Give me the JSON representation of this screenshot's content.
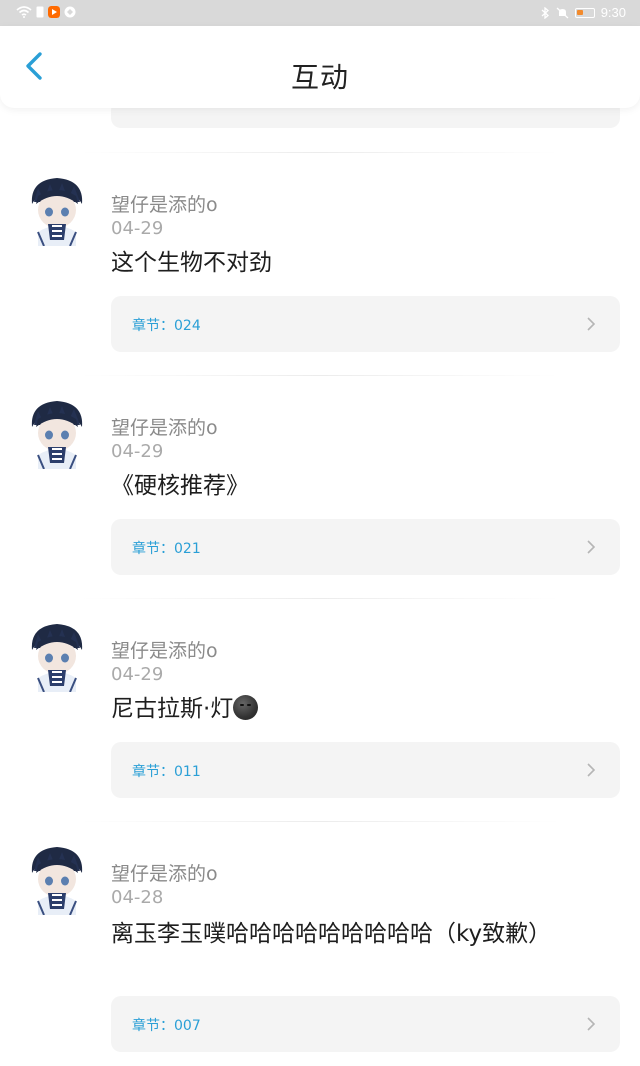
{
  "status": {
    "time": "9:30",
    "colors": {
      "bar": "#d9d9d9",
      "battery_fill": "#f28a2c",
      "app1": "#ff6a00",
      "app2": "#ffffff"
    }
  },
  "header": {
    "title": "互动",
    "back_icon": "chevron-left-icon",
    "accent": "#2a9fd6"
  },
  "items": [
    {
      "user": "望仔是添的o",
      "date": "04-29",
      "content": "这个生物不对劲",
      "chapter": "章节：024"
    },
    {
      "user": "望仔是添的o",
      "date": "04-29",
      "content": "《硬核推荐》",
      "chapter": "章节：021"
    },
    {
      "user": "望仔是添的o",
      "date": "04-29",
      "content": "尼古拉斯·灯",
      "emoji": "dark-moon-face-emoji",
      "chapter": "章节：011"
    },
    {
      "user": "望仔是添的o",
      "date": "04-28",
      "content": "离玉李玉噗哈哈哈哈哈哈哈哈哈（ky致歉）",
      "chapter": "章节：007"
    }
  ]
}
